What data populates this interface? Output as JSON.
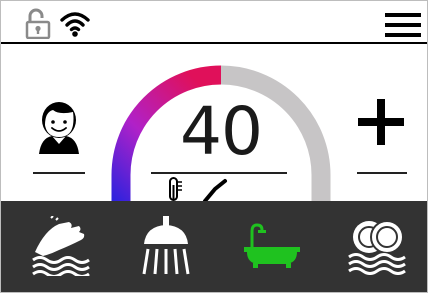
{
  "status": {
    "lock_icon": "unlocked-padlock-icon",
    "wifi_icon": "wifi-icon",
    "menu_icon": "hamburger-menu-icon"
  },
  "temperature": {
    "value": "40",
    "gauge_fraction": 0.47,
    "gauge_colors": [
      "#1e22e0",
      "#b021c8",
      "#e0105a"
    ],
    "track_color": "#c7c5c6"
  },
  "controls": {
    "user_icon": "user-avatar-icon",
    "increase_icon": "plus-icon",
    "thermometer_icon": "thermometer-check-icon"
  },
  "modes": [
    {
      "icon": "hand-wash-icon",
      "color": "#ffffff",
      "selected": false
    },
    {
      "icon": "shower-icon",
      "color": "#ffffff",
      "selected": false
    },
    {
      "icon": "bathtub-icon",
      "color": "#1fc21f",
      "selected": true
    },
    {
      "icon": "dishes-icon",
      "color": "#ffffff",
      "selected": false
    }
  ]
}
